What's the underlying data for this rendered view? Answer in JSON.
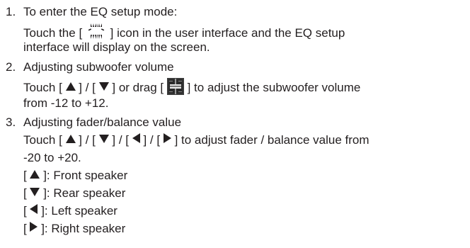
{
  "items": [
    {
      "number": "1.",
      "heading": "To enter the EQ setup mode:",
      "line1_pre": "Touch the [",
      "eq_icon": "eq-setup-icon",
      "line1_post": "] icon in the user interface and the EQ setup",
      "line2": "interface will display on the screen."
    },
    {
      "number": "2.",
      "heading": "Adjusting subwoofer volume",
      "line1_a": "Touch [",
      "line1_b": "] / [",
      "line1_c": "] or drag [",
      "line1_d": "] to adjust the subwoofer volume",
      "line2": "from -12 to +12."
    },
    {
      "number": "3.",
      "heading": "Adjusting fader/balance value",
      "line1_a": "Touch [",
      "line1_b": "] / [",
      "line1_c": "] / [",
      "line1_d": "] / [",
      "line1_e": "] to adjust  fader / balance value from",
      "line2": "-20 to +20.",
      "keys": [
        {
          "pre": "[",
          "post": "]: Front speaker",
          "icon": "up-arrow-icon"
        },
        {
          "pre": "[",
          "post": "]: Rear speaker",
          "icon": "down-arrow-icon"
        },
        {
          "pre": "[",
          "post": "]: Left speaker",
          "icon": "left-arrow-icon"
        },
        {
          "pre": "[",
          "post": "]: Right speaker",
          "icon": "right-arrow-icon"
        }
      ]
    }
  ]
}
